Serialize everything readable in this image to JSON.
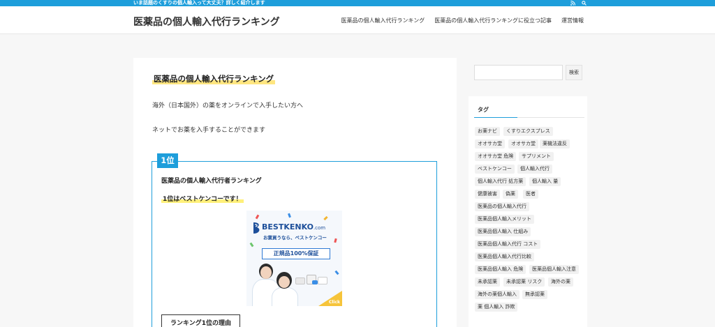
{
  "topbar": {
    "notice": "いま話題のくすりの個人輸入って大丈夫？詳しく紹介します",
    "rss_icon": "rss-icon",
    "search_icon": "search-icon",
    "color": "#1e9edb"
  },
  "header": {
    "site_title": "医薬品の個人輸入代行ランキング",
    "nav": [
      "医薬品の個人輸入代行ランキング",
      "医薬品の個人輸入代行ランキングに役立つ記事",
      "運営情報"
    ]
  },
  "main": {
    "heading": "医薬品の個人輸入代行ランキング",
    "para1": "海外（日本国外）の薬をオンラインで入手したい方へ",
    "para2": "ネットでお薬を入手することができます",
    "rank": {
      "badge": "1位",
      "title": "医薬品の個人輸入代行者ランキング",
      "first": "1位はベストケンコーです！",
      "banner": {
        "logo": "BESTKENKO",
        "logo_suffix": ".com",
        "tagline": "お薬買うなら、ベストケンコー",
        "guarantee": "正規品100%保証",
        "click": "Click"
      },
      "reason_button": "ランキング1位の理由"
    }
  },
  "sidebar": {
    "search_placeholder": "",
    "search_button": "検索",
    "tags_title": "タグ",
    "tags": [
      [
        "お薬ナビ",
        "くすりエクスプレス"
      ],
      [
        "オオサカ堂",
        "オオサカ堂",
        "薬機法違反"
      ],
      [
        "オオサカ堂 危険",
        "サプリメント"
      ],
      [
        "ベストケンコー",
        "個人輸入代行"
      ],
      [
        "個人輸入代行 処方薬",
        "個人輸入 量"
      ],
      [
        "健康被害",
        "偽薬",
        "医者"
      ],
      [
        "医薬品の個人輸入代行"
      ],
      [
        "医薬品個人輸入メリット"
      ],
      [
        "医薬品個人輸入 仕組み"
      ],
      [
        "医薬品個人輸入代行 コスト"
      ],
      [
        "医薬品個人輸入代行比較"
      ],
      [
        "医薬品個人輸入 危険",
        "医薬品個人輸入注意"
      ],
      [
        "未承認薬",
        "未承認薬 リスク",
        "海外の薬"
      ],
      [
        "海外の薬個人輸入",
        "無承認薬"
      ],
      [
        "薬 個人輸入 詐欺"
      ]
    ]
  }
}
